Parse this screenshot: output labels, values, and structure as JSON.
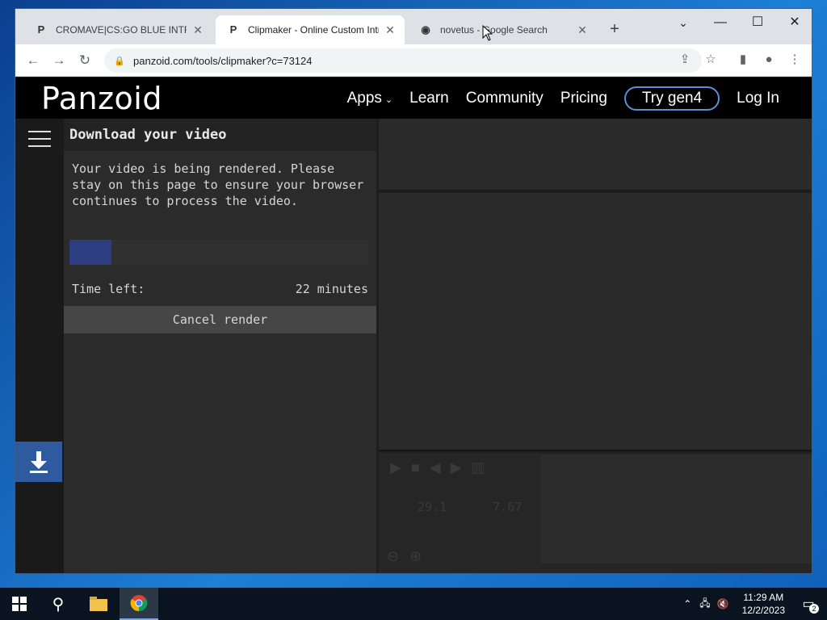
{
  "browser": {
    "tabs": [
      {
        "title": "CROMAVE|CS:GO BLUE INTRO TI",
        "icon": "panzoid-favicon",
        "active": false
      },
      {
        "title": "Clipmaker - Online Custom Intro",
        "icon": "panzoid-favicon",
        "active": true
      },
      {
        "title": "novetus - Google Search",
        "icon": "google-favicon",
        "active": false
      }
    ],
    "new_tab": "+",
    "window_controls": {
      "minimize": "—",
      "maximize": "☐",
      "close": "✕",
      "tab_search": "⌄"
    },
    "toolbar": {
      "back": "←",
      "forward": "→",
      "reload": "↻"
    },
    "url": "panzoid.com/tools/clipmaker?c=73124",
    "omnibox_icons": [
      "share-icon",
      "star-icon",
      "sidepanel-icon",
      "profile-icon",
      "menu-icon"
    ]
  },
  "site": {
    "logo": "Panzoid",
    "nav": {
      "apps": "Apps",
      "learn": "Learn",
      "community": "Community",
      "pricing": "Pricing",
      "try": "Try gen4",
      "login": "Log In"
    }
  },
  "panel": {
    "title": "Download your video",
    "message": "Your video is being rendered. Please stay on this page to ensure your browser continues to process the video.",
    "progress": 0.14,
    "time_left_label": "Time left:",
    "time_left_value": "22 minutes",
    "cancel_label": "Cancel render"
  },
  "timeline": {
    "current": "29.1",
    "total": "7.67"
  },
  "taskbar": {
    "time": "11:29 AM",
    "date": "12/2/2023",
    "notifications": "2"
  },
  "colors": {
    "progress_fill": "#2c3e80",
    "download_tab": "#2f5aa0",
    "try_border": "#5b8fd6"
  }
}
